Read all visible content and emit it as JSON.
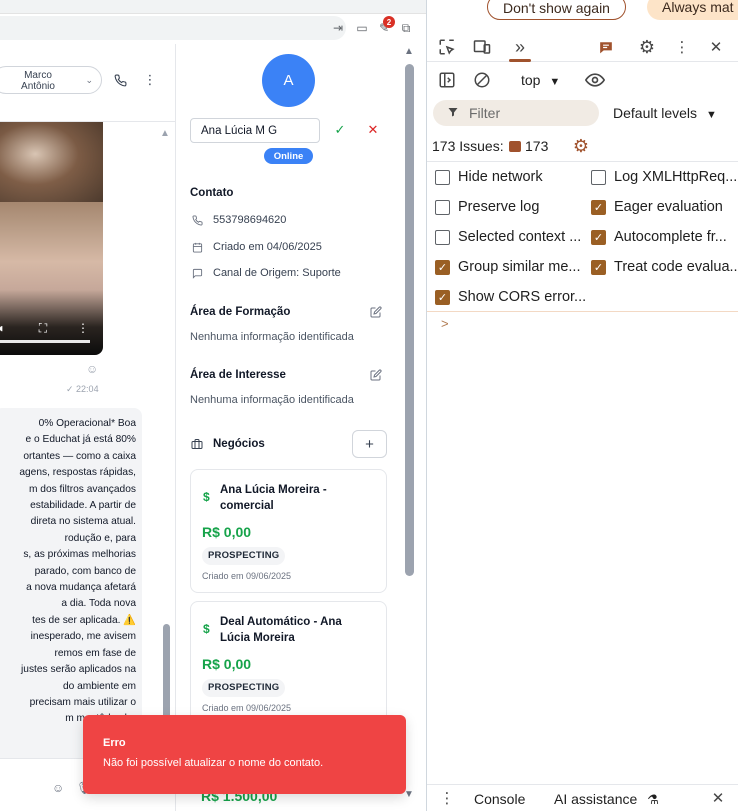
{
  "chat": {
    "agent_name_line1": "Marco",
    "agent_name_line2": "Antônio",
    "message_time": "22:04",
    "message_text": "0% Operacional* Boa\ne o Educhat já está 80%\nortantes — como a caixa\nagens, respostas rápidas,\nm dos filtros avançados\nestabilidade. A partir de\ndireta no sistema atual.\nrodução e, para\ns, as próximas melhorias\nparado, com banco de\na nova mudança afetará\na dia. Toda nova\ntes de ser aplicada. ⚠️\ninesperado, me avisem\nremos em fase de\njustes serão aplicados na\ndo ambiente em\nprecisam mais utilizar o\nm mantê-lo abe\n"
  },
  "contact": {
    "avatar_initial": "A",
    "name_value": "Ana Lúcia M G",
    "status": "Online",
    "contact_section": "Contato",
    "phone": "553798694620",
    "created": "Criado em 04/06/2025",
    "origin": "Canal de Origem: Suporte",
    "formation_title": "Área de Formação",
    "formation_value": "Nenhuma informação identificada",
    "interest_title": "Área de Interesse",
    "interest_value": "Nenhuma informação identificada",
    "deals_title": "Negócios",
    "deals": [
      {
        "title": "Ana Lúcia Moreira - comercial",
        "amount": "R$ 0,00",
        "stage": "PROSPECTING",
        "created": "Criado em 09/06/2025"
      },
      {
        "title": "Deal Automático - Ana Lúcia Moreira",
        "amount": "R$ 0,00",
        "stage": "PROSPECTING",
        "created": "Criado em 09/06/2025"
      }
    ],
    "partial_amount": "R$ 1.500,00"
  },
  "toast": {
    "title": "Erro",
    "message": "Não foi possível atualizar o nome do contato."
  },
  "browser": {
    "extension_badge": "2"
  },
  "devtools": {
    "infobar": {
      "dont_show": "Don't show again",
      "always": "Always mat"
    },
    "context": "top",
    "filter_placeholder": "Filter",
    "levels": "Default levels",
    "issues_label": "173 Issues:",
    "issues_count": "173",
    "settings": [
      {
        "label": "Hide network",
        "checked": false
      },
      {
        "label": "Log XMLHttpReq...",
        "checked": false
      },
      {
        "label": "Preserve log",
        "checked": false
      },
      {
        "label": "Eager evaluation",
        "checked": true
      },
      {
        "label": "Selected context ...",
        "checked": false
      },
      {
        "label": "Autocomplete fr...",
        "checked": true
      },
      {
        "label": "Group similar me...",
        "checked": true
      },
      {
        "label": "Treat code evalua...",
        "checked": true
      },
      {
        "label": "Show CORS error...",
        "checked": true
      }
    ],
    "prompt_symbol": ">",
    "drawer_tabs": {
      "console": "Console",
      "ai": "AI assistance"
    }
  },
  "colors": {
    "accent_blue": "#3b82f6",
    "success_green": "#16a34a",
    "error_red": "#ef4444",
    "devtools_accent": "#a0522d"
  }
}
